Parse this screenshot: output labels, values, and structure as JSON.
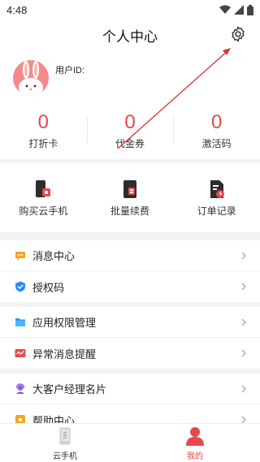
{
  "status_bar": {
    "time": "4:48"
  },
  "header": {
    "title": "个人中心",
    "settings_icon": "gear-icon"
  },
  "profile": {
    "uid_label": "用户ID:",
    "avatar": "rabbit-avatar"
  },
  "stats": [
    {
      "value": "0",
      "label": "打折卡"
    },
    {
      "value": "0",
      "label": "代金券"
    },
    {
      "value": "0",
      "label": "激活码"
    }
  ],
  "actions": [
    {
      "label": "购买云手机",
      "icon": "phone-buy-icon"
    },
    {
      "label": "批量续费",
      "icon": "phone-renew-icon"
    },
    {
      "label": "订单记录",
      "icon": "order-record-icon"
    }
  ],
  "group1": [
    {
      "label": "消息中心",
      "icon": "message-icon",
      "color": "#f5a623"
    },
    {
      "label": "授权码",
      "icon": "shield-check-icon",
      "color": "#2a8cf0"
    }
  ],
  "group2": [
    {
      "label": "应用权限管理",
      "icon": "folder-icon",
      "color": "#2a9df4"
    },
    {
      "label": "异常消息提醒",
      "icon": "alert-chart-icon",
      "color": "#e8474c"
    }
  ],
  "group3": [
    {
      "label": "大客户经理名片",
      "icon": "headset-icon",
      "color": "#8e5ad6"
    },
    {
      "label": "帮助中心",
      "icon": "help-icon",
      "color": "#f5a623"
    }
  ],
  "tabbar": [
    {
      "label": "云手机",
      "icon": "cloud-phone-icon",
      "active": false
    },
    {
      "label": "我的",
      "icon": "person-icon",
      "active": true
    }
  ],
  "colors": {
    "accent": "#e8474c",
    "text": "#222222",
    "background": "#f3f3f3"
  }
}
